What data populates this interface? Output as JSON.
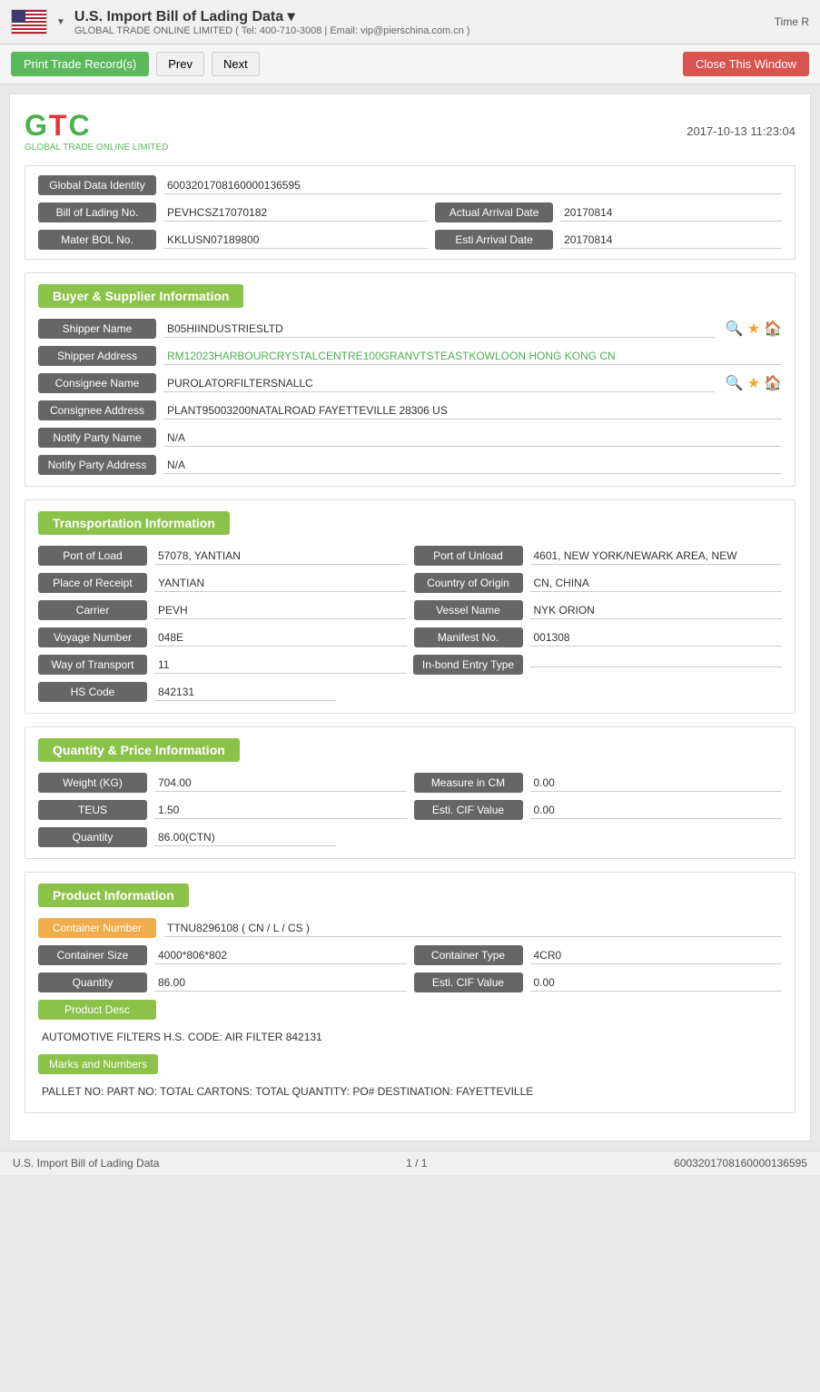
{
  "header": {
    "title": "U.S. Import Bill of Lading Data ▾",
    "subtitle": "GLOBAL TRADE ONLINE LIMITED ( Tel: 400-710-3008 | Email: vip@pierschina.com.cn )",
    "time_label": "Time R"
  },
  "toolbar": {
    "print_label": "Print Trade Record(s)",
    "prev_label": "Prev",
    "next_label": "Next",
    "close_label": "Close This Window"
  },
  "logo": {
    "timestamp": "2017-10-13 11:23:04",
    "company": "GLOBAL TRADE ONLINE LIMITED"
  },
  "identity": {
    "global_data_label": "Global Data Identity",
    "global_data_value": "6003201708160000136595",
    "bol_label": "Bill of Lading No.",
    "bol_value": "PEVHCSZ17070182",
    "actual_arrival_label": "Actual Arrival Date",
    "actual_arrival_value": "20170814",
    "master_bol_label": "Mater BOL No.",
    "master_bol_value": "KKLUSN07189800",
    "esti_arrival_label": "Esti Arrival Date",
    "esti_arrival_value": "20170814"
  },
  "buyer_supplier": {
    "section_title": "Buyer & Supplier Information",
    "shipper_name_label": "Shipper Name",
    "shipper_name_value": "B05HIINDUSTRIESLTD",
    "shipper_addr_label": "Shipper Address",
    "shipper_addr_value": "RM12023HARBOURCRYSTALCENTRE100GRANVTSTEASTKOWLOON HONG KONG CN",
    "consignee_name_label": "Consignee Name",
    "consignee_name_value": "PUROLATORFILTERSNALLC",
    "consignee_addr_label": "Consignee Address",
    "consignee_addr_value": "PLANT95003200NATALROAD FAYETTEVILLE 28306 US",
    "notify_party_name_label": "Notify Party Name",
    "notify_party_name_value": "N/A",
    "notify_party_addr_label": "Notify Party Address",
    "notify_party_addr_value": "N/A"
  },
  "transportation": {
    "section_title": "Transportation Information",
    "port_of_load_label": "Port of Load",
    "port_of_load_value": "57078, YANTIAN",
    "port_of_unload_label": "Port of Unload",
    "port_of_unload_value": "4601, NEW YORK/NEWARK AREA, NEW",
    "place_of_receipt_label": "Place of Receipt",
    "place_of_receipt_value": "YANTIAN",
    "country_of_origin_label": "Country of Origin",
    "country_of_origin_value": "CN, CHINA",
    "carrier_label": "Carrier",
    "carrier_value": "PEVH",
    "vessel_name_label": "Vessel Name",
    "vessel_name_value": "NYK ORION",
    "voyage_number_label": "Voyage Number",
    "voyage_number_value": "048E",
    "manifest_no_label": "Manifest No.",
    "manifest_no_value": "001308",
    "way_of_transport_label": "Way of Transport",
    "way_of_transport_value": "11",
    "in_bond_label": "In-bond Entry Type",
    "in_bond_value": "",
    "hs_code_label": "HS Code",
    "hs_code_value": "842131"
  },
  "quantity_price": {
    "section_title": "Quantity & Price Information",
    "weight_label": "Weight (KG)",
    "weight_value": "704.00",
    "measure_label": "Measure in CM",
    "measure_value": "0.00",
    "teus_label": "TEUS",
    "teus_value": "1.50",
    "esti_cif_label": "Esti. CIF Value",
    "esti_cif_value": "0.00",
    "quantity_label": "Quantity",
    "quantity_value": "86.00(CTN)"
  },
  "product": {
    "section_title": "Product Information",
    "container_number_label": "Container Number",
    "container_number_value": "TTNU8296108 ( CN / L / CS )",
    "container_size_label": "Container Size",
    "container_size_value": "4000*806*802",
    "container_type_label": "Container Type",
    "container_type_value": "4CR0",
    "quantity_label": "Quantity",
    "quantity_value": "86.00",
    "esti_cif_label": "Esti. CIF Value",
    "esti_cif_value": "0.00",
    "product_desc_label": "Product Desc",
    "product_desc_value": "AUTOMOTIVE FILTERS H.S. CODE: AIR FILTER 842131",
    "marks_label": "Marks and Numbers",
    "marks_value": "PALLET NO: PART NO: TOTAL CARTONS: TOTAL QUANTITY: PO# DESTINATION: FAYETTEVILLE"
  },
  "footer": {
    "left": "U.S. Import Bill of Lading Data",
    "center": "1 / 1",
    "right": "6003201708160000136595"
  }
}
